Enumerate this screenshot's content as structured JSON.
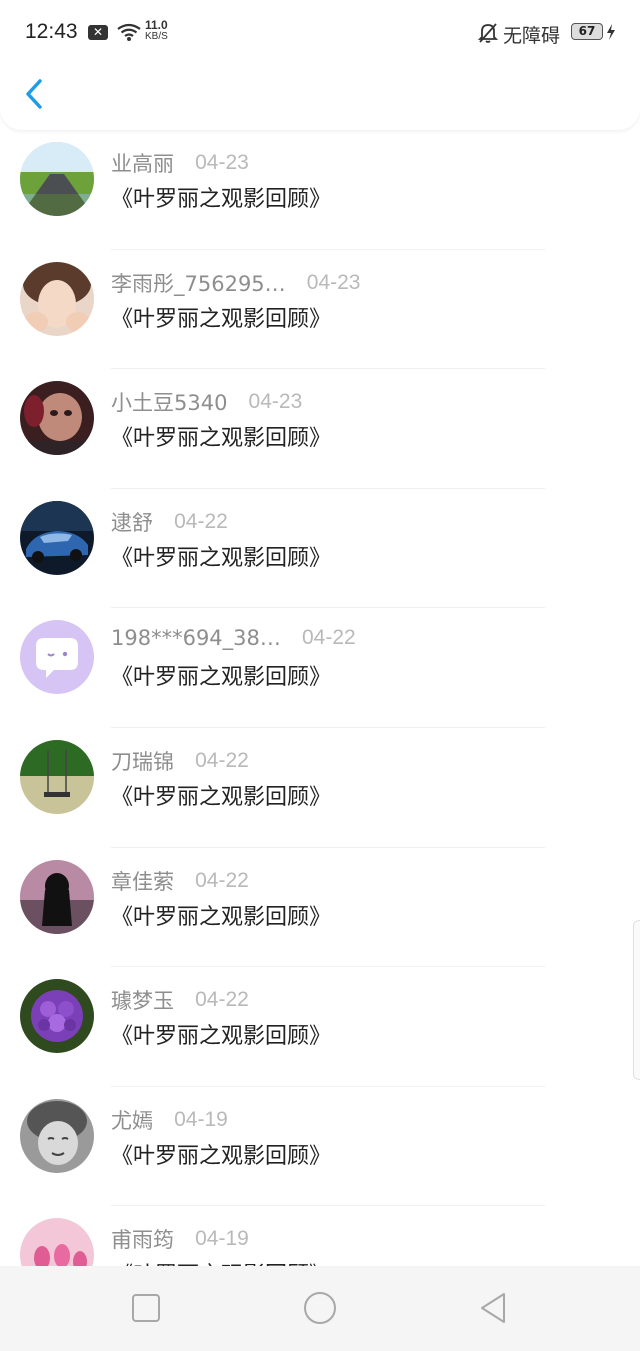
{
  "status_bar": {
    "time": "12:43",
    "speed_value": "11.0",
    "speed_unit": "KB/S",
    "accessibility_label": "无障碍",
    "battery": "67"
  },
  "header": {
    "back_icon": "chevron-left-icon",
    "accent_color": "#1f9ce6"
  },
  "items": [
    {
      "name": "业高丽",
      "date": "04-23",
      "title": "《叶罗丽之观影回顾》"
    },
    {
      "name": "李雨彤_756295…",
      "date": "04-23",
      "title": "《叶罗丽之观影回顾》"
    },
    {
      "name": "小土豆5340",
      "date": "04-23",
      "title": "《叶罗丽之观影回顾》"
    },
    {
      "name": "逮舒",
      "date": "04-22",
      "title": "《叶罗丽之观影回顾》"
    },
    {
      "name": "198***694_38…",
      "date": "04-22",
      "title": "《叶罗丽之观影回顾》"
    },
    {
      "name": "刀瑞锦",
      "date": "04-22",
      "title": "《叶罗丽之观影回顾》"
    },
    {
      "name": "章佳萦",
      "date": "04-22",
      "title": "《叶罗丽之观影回顾》"
    },
    {
      "name": "璩梦玉",
      "date": "04-22",
      "title": "《叶罗丽之观影回顾》"
    },
    {
      "name": "尤嫣",
      "date": "04-19",
      "title": "《叶罗丽之观影回顾》"
    },
    {
      "name": "甫雨筠",
      "date": "04-19",
      "title": "《叶罗丽之观影回顾》"
    }
  ],
  "nav_bar": {
    "recents_icon": "square-icon",
    "home_icon": "circle-icon",
    "back_icon": "triangle-back-icon"
  }
}
